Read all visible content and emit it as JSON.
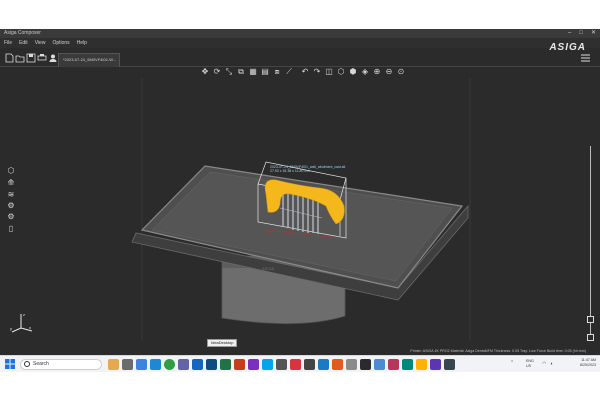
{
  "window": {
    "title": "Asiga Composer",
    "controls": [
      "–",
      "□",
      "✕"
    ]
  },
  "menu": {
    "items": [
      "File",
      "Edit",
      "View",
      "Options",
      "Help"
    ]
  },
  "brand": "ASIGA",
  "document_tab": {
    "label": "*2023-07-24_5M0VF4I01-W..."
  },
  "model_label": {
    "name": "2023-07-24_5M0VF4I01_wall_abutment_cast.stl",
    "dims": "27.93 x 18.38 x 11.80 mm"
  },
  "tooltip": "IdeaDesktop",
  "status": {
    "text": "Printer: ASIGA 4K PRO2   Material: Asiga DentaMFM   Thickness: 0.05   Tray: Low Force   Build time: 0:05 (hh:mm)"
  },
  "taskbar": {
    "search_placeholder": "Search",
    "lang_line1": "ENG",
    "lang_line2": "US",
    "time": "11:47 AM",
    "date": "8/25/2023"
  },
  "colors": {
    "app_background": "#2b2b2b",
    "platform": "#4a4a4a",
    "model_yellow": "#f4b81c",
    "supports": "#b9bfc6",
    "taskbar": "#f1f3f6"
  },
  "icons": {
    "viewbar": [
      "move-icon",
      "rotate-icon",
      "scale-icon",
      "mirror-icon",
      "arrange-icon",
      "layout-icon",
      "duplicate-icon",
      "measure-icon",
      "undo-icon",
      "redo-icon",
      "view-front-icon",
      "view-top-icon",
      "view-side-icon",
      "view-iso-icon",
      "zoom-in-icon",
      "zoom-out-icon",
      "zoom-fit-icon"
    ],
    "sidebar": [
      "cube-icon",
      "support-icon",
      "layers-icon",
      "slice-icon",
      "settings-icon",
      "tablet-icon"
    ]
  }
}
